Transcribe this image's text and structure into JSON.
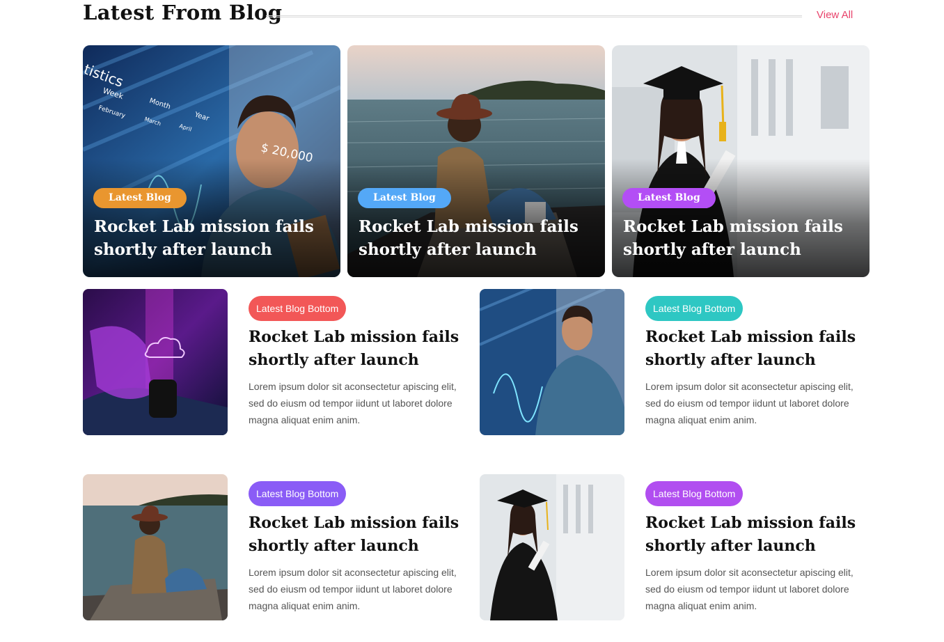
{
  "section": {
    "title": "Latest From Blog",
    "view_all": "View All"
  },
  "colors": {
    "view_all": "#e8436b",
    "badge_orange": "#e9962f",
    "badge_blue": "#54a8f7",
    "badge_purple": "#b34ef5",
    "badge_red": "#f25757",
    "badge_teal": "#2ec7c3",
    "badge_violet": "#8a5cf6",
    "badge_magenta": "#b14ef0"
  },
  "top_posts": [
    {
      "badge": "Latest Blog",
      "title": "Rocket Lab mission fails shortly after launch",
      "image": "man-with-statistics-image"
    },
    {
      "badge": "Latest Blog",
      "title": "Rocket Lab mission fails shortly after launch",
      "image": "woman-by-sea-image"
    },
    {
      "badge": "Latest Blog",
      "title": "Rocket Lab mission fails shortly after launch",
      "image": "graduate-image"
    }
  ],
  "bottom_posts": [
    {
      "badge": "Latest Blog Bottom",
      "title": "Rocket Lab mission fails shortly after launch",
      "excerpt": "Lorem ipsum dolor sit aconsectetur apiscing elit, sed do eiusm od tempor iidunt ut laboret dolore magna aliquat enim anim.",
      "image": "smartwatch-cloud-image"
    },
    {
      "badge": "Latest Blog Bottom",
      "title": "Rocket Lab mission fails shortly after launch",
      "excerpt": "Lorem ipsum dolor sit aconsectetur apiscing elit, sed do eiusm od tempor iidunt ut laboret dolore magna aliquat enim anim.",
      "image": "man-with-statistics-image"
    },
    {
      "badge": "Latest Blog Bottom",
      "title": "Rocket Lab mission fails shortly after launch",
      "excerpt": "Lorem ipsum dolor sit aconsectetur apiscing elit, sed do eiusm od tempor iidunt ut laboret dolore magna aliquat enim anim.",
      "image": "woman-by-sea-image"
    },
    {
      "badge": "Latest Blog Bottom",
      "title": "Rocket Lab mission fails shortly after launch",
      "excerpt": "Lorem ipsum dolor sit aconsectetur apiscing elit, sed do eiusm od tempor iidunt ut laboret dolore magna aliquat enim anim.",
      "image": "graduate-image"
    }
  ],
  "image_texts": {
    "statistics": "tistics",
    "week": "Week",
    "month": "Month",
    "year": "Year",
    "february": "February",
    "march": "March",
    "april": "April",
    "amount": "$ 20,000"
  }
}
